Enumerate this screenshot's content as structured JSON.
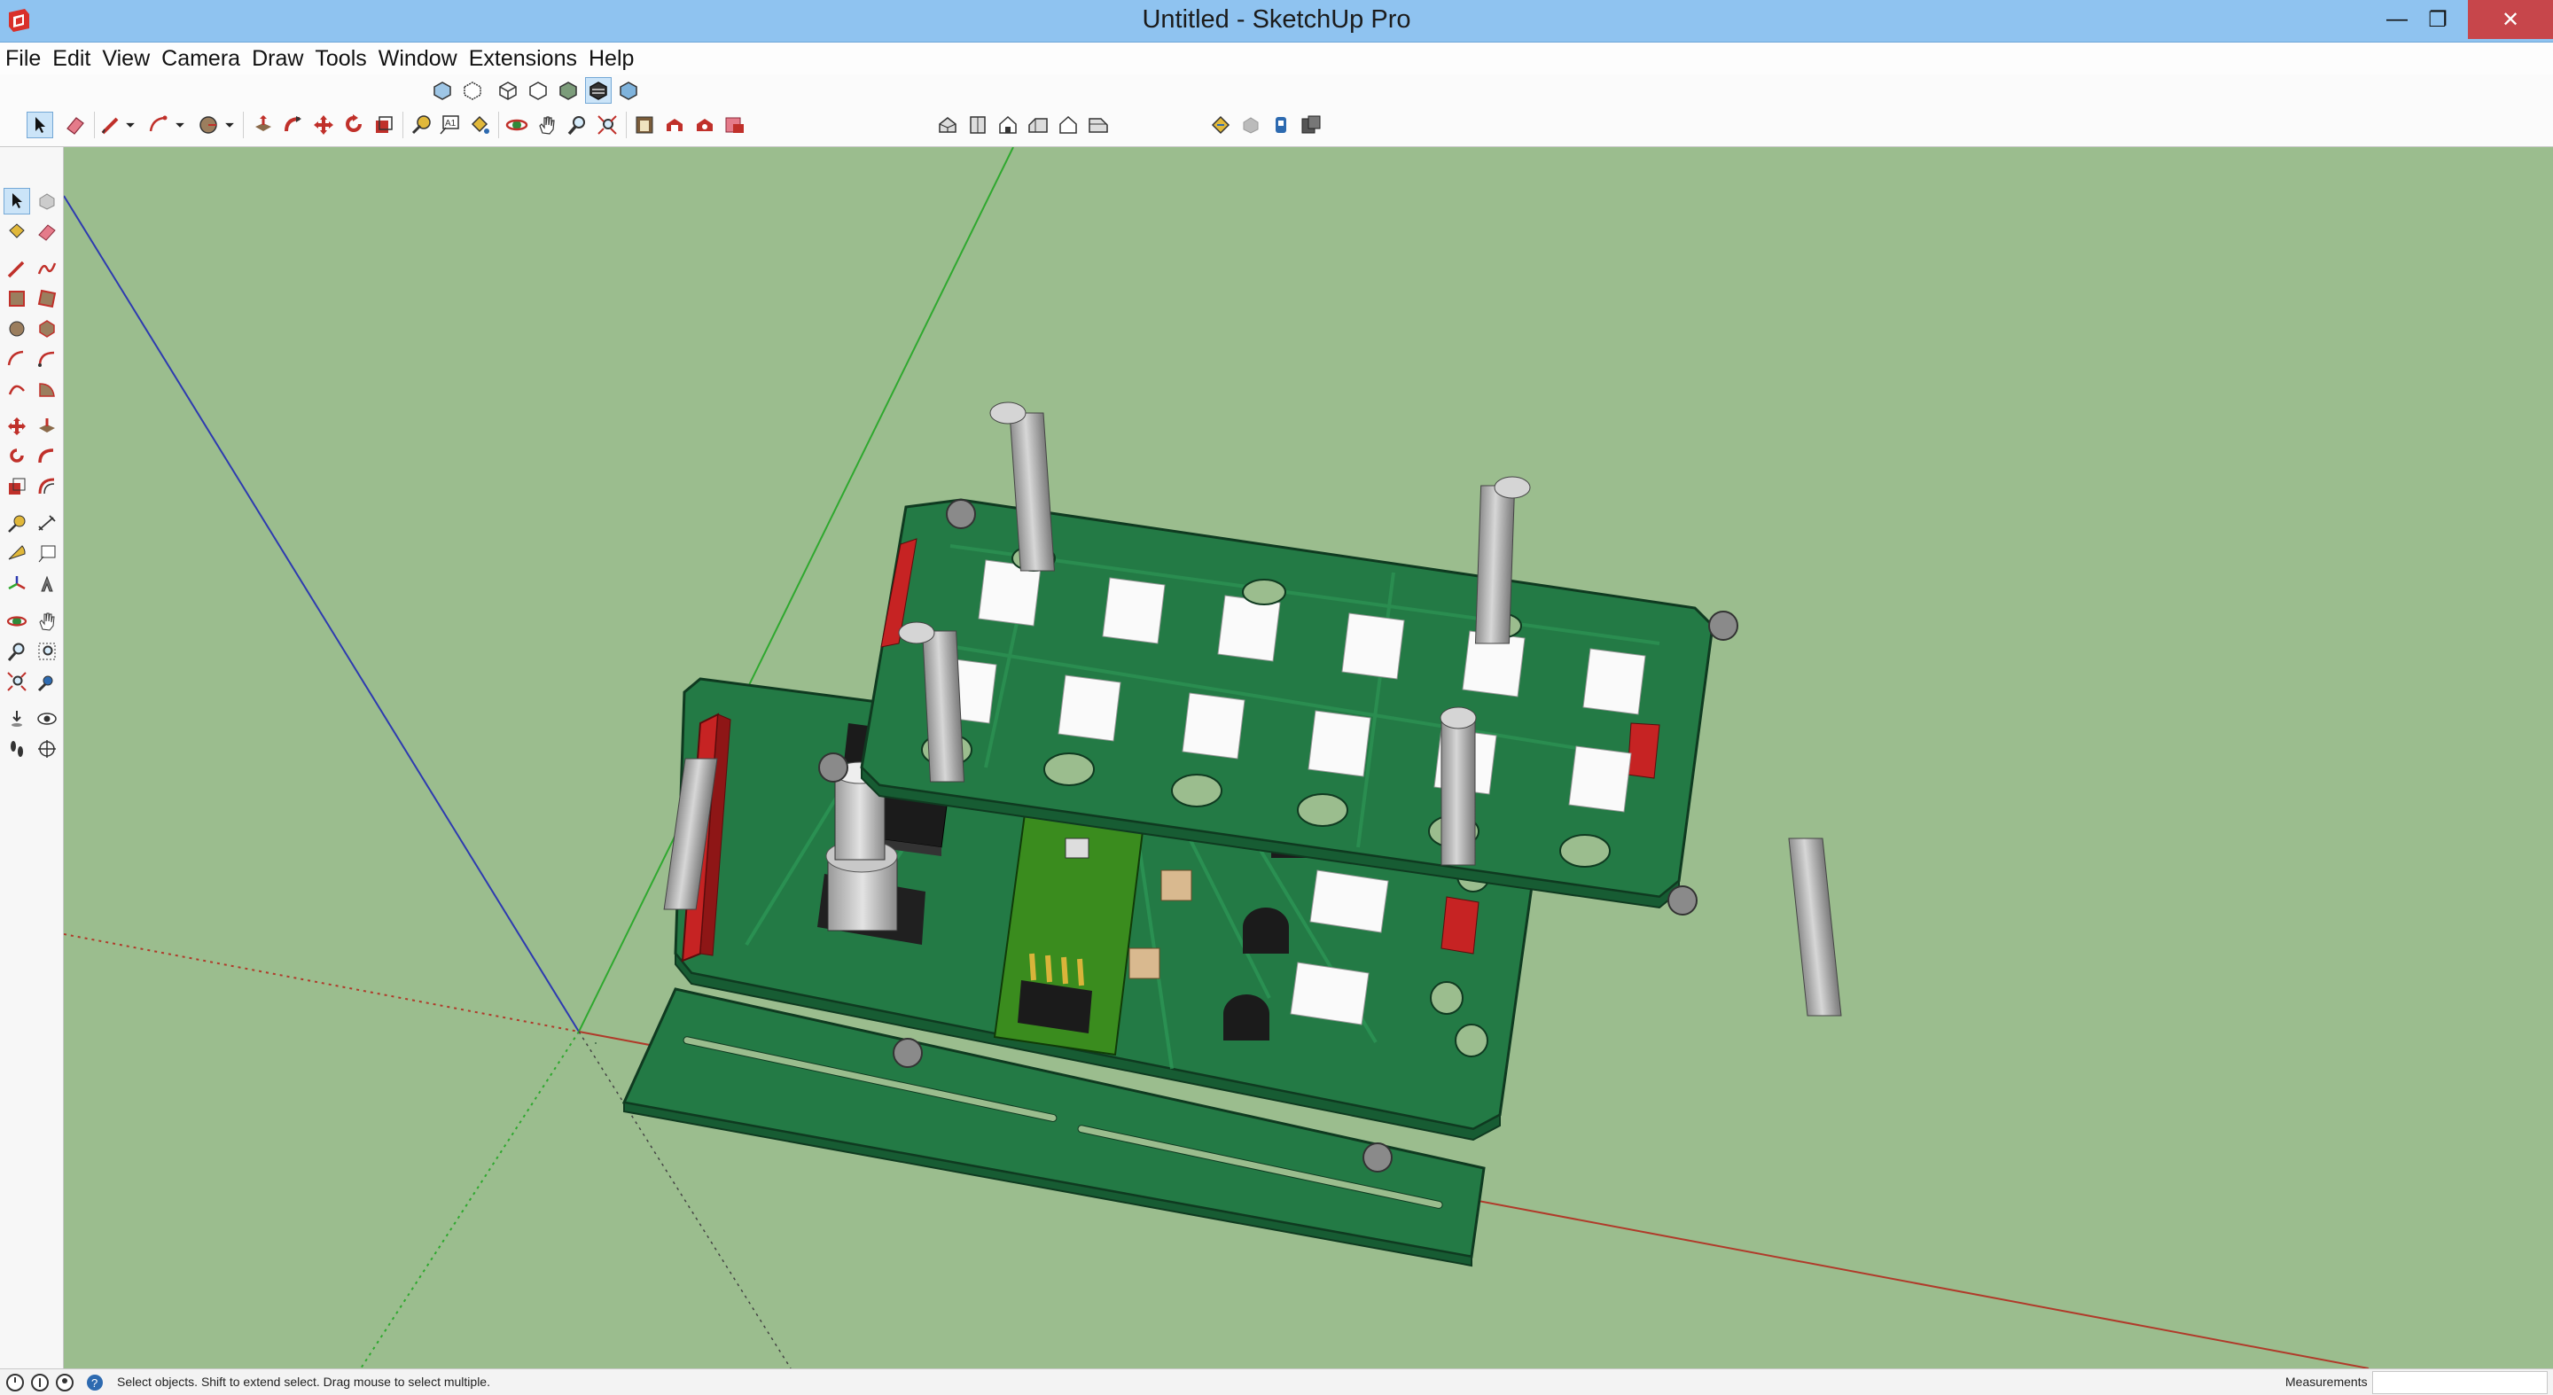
{
  "window": {
    "title": "Untitled - SketchUp Pro",
    "min_glyph": "—",
    "max_glyph": "❐",
    "close_glyph": "✕"
  },
  "menu": [
    "File",
    "Edit",
    "View",
    "Camera",
    "Draw",
    "Tools",
    "Window",
    "Extensions",
    "Help"
  ],
  "toolbar_styles": [
    "xray-style",
    "back-edges-style",
    "wireframe-style",
    "hidden-line-style",
    "shaded-style",
    "shaded-textures-style",
    "monochrome-style"
  ],
  "toolbar_main": [
    "select",
    "eraser",
    "line",
    "arc",
    "circle",
    "push-pull",
    "follow-me",
    "move",
    "rotate",
    "scale",
    "tape-measure",
    "text",
    "paint-bucket",
    "orbit",
    "pan",
    "zoom",
    "zoom-extents",
    "warehouse",
    "share-model",
    "extension-warehouse",
    "layout"
  ],
  "toolbar_views": [
    "iso-view",
    "top-view",
    "front-view",
    "right-view",
    "back-view",
    "left-view"
  ],
  "toolbar_extras": [
    "section-plane",
    "display-section-planes",
    "display-section-cuts",
    "extension-manager"
  ],
  "status": {
    "text": "Select objects. Shift to extend select. Drag mouse to select multiple.",
    "measurements_label": "Measurements",
    "measurements_value": ""
  },
  "colors": {
    "viewport": "#9bbd8e",
    "pcb": "#237a45",
    "pcb_dark": "#175c33",
    "titlebar": "#8fc3f0",
    "red_axis": "#b03a2a",
    "green_axis": "#2fa82f",
    "blue_axis": "#2d3ab0"
  }
}
